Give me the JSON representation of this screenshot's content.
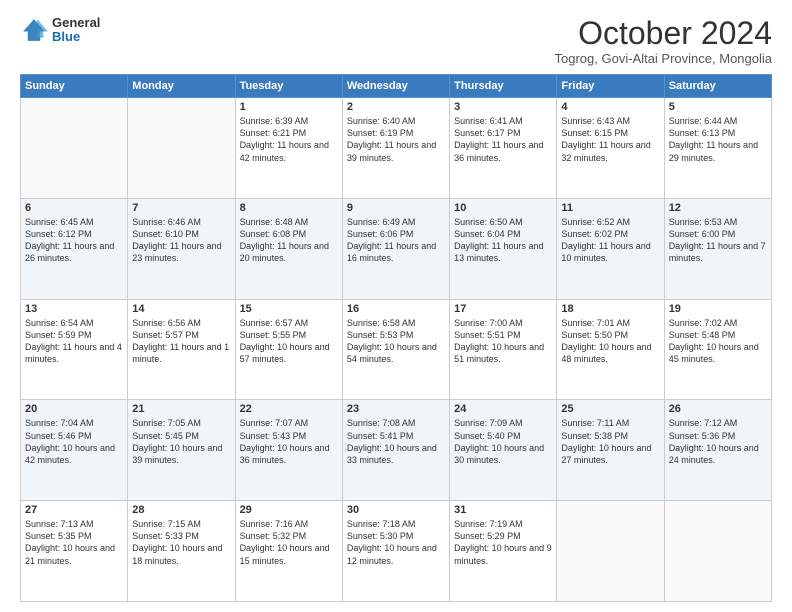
{
  "header": {
    "logo_line1": "General",
    "logo_line2": "Blue",
    "month": "October 2024",
    "location": "Togrog, Govi-Altai Province, Mongolia"
  },
  "weekdays": [
    "Sunday",
    "Monday",
    "Tuesday",
    "Wednesday",
    "Thursday",
    "Friday",
    "Saturday"
  ],
  "weeks": [
    [
      {
        "day": "",
        "info": ""
      },
      {
        "day": "",
        "info": ""
      },
      {
        "day": "1",
        "info": "Sunrise: 6:39 AM\nSunset: 6:21 PM\nDaylight: 11 hours and 42 minutes."
      },
      {
        "day": "2",
        "info": "Sunrise: 6:40 AM\nSunset: 6:19 PM\nDaylight: 11 hours and 39 minutes."
      },
      {
        "day": "3",
        "info": "Sunrise: 6:41 AM\nSunset: 6:17 PM\nDaylight: 11 hours and 36 minutes."
      },
      {
        "day": "4",
        "info": "Sunrise: 6:43 AM\nSunset: 6:15 PM\nDaylight: 11 hours and 32 minutes."
      },
      {
        "day": "5",
        "info": "Sunrise: 6:44 AM\nSunset: 6:13 PM\nDaylight: 11 hours and 29 minutes."
      }
    ],
    [
      {
        "day": "6",
        "info": "Sunrise: 6:45 AM\nSunset: 6:12 PM\nDaylight: 11 hours and 26 minutes."
      },
      {
        "day": "7",
        "info": "Sunrise: 6:46 AM\nSunset: 6:10 PM\nDaylight: 11 hours and 23 minutes."
      },
      {
        "day": "8",
        "info": "Sunrise: 6:48 AM\nSunset: 6:08 PM\nDaylight: 11 hours and 20 minutes."
      },
      {
        "day": "9",
        "info": "Sunrise: 6:49 AM\nSunset: 6:06 PM\nDaylight: 11 hours and 16 minutes."
      },
      {
        "day": "10",
        "info": "Sunrise: 6:50 AM\nSunset: 6:04 PM\nDaylight: 11 hours and 13 minutes."
      },
      {
        "day": "11",
        "info": "Sunrise: 6:52 AM\nSunset: 6:02 PM\nDaylight: 11 hours and 10 minutes."
      },
      {
        "day": "12",
        "info": "Sunrise: 6:53 AM\nSunset: 6:00 PM\nDaylight: 11 hours and 7 minutes."
      }
    ],
    [
      {
        "day": "13",
        "info": "Sunrise: 6:54 AM\nSunset: 5:59 PM\nDaylight: 11 hours and 4 minutes."
      },
      {
        "day": "14",
        "info": "Sunrise: 6:56 AM\nSunset: 5:57 PM\nDaylight: 11 hours and 1 minute."
      },
      {
        "day": "15",
        "info": "Sunrise: 6:57 AM\nSunset: 5:55 PM\nDaylight: 10 hours and 57 minutes."
      },
      {
        "day": "16",
        "info": "Sunrise: 6:58 AM\nSunset: 5:53 PM\nDaylight: 10 hours and 54 minutes."
      },
      {
        "day": "17",
        "info": "Sunrise: 7:00 AM\nSunset: 5:51 PM\nDaylight: 10 hours and 51 minutes."
      },
      {
        "day": "18",
        "info": "Sunrise: 7:01 AM\nSunset: 5:50 PM\nDaylight: 10 hours and 48 minutes."
      },
      {
        "day": "19",
        "info": "Sunrise: 7:02 AM\nSunset: 5:48 PM\nDaylight: 10 hours and 45 minutes."
      }
    ],
    [
      {
        "day": "20",
        "info": "Sunrise: 7:04 AM\nSunset: 5:46 PM\nDaylight: 10 hours and 42 minutes."
      },
      {
        "day": "21",
        "info": "Sunrise: 7:05 AM\nSunset: 5:45 PM\nDaylight: 10 hours and 39 minutes."
      },
      {
        "day": "22",
        "info": "Sunrise: 7:07 AM\nSunset: 5:43 PM\nDaylight: 10 hours and 36 minutes."
      },
      {
        "day": "23",
        "info": "Sunrise: 7:08 AM\nSunset: 5:41 PM\nDaylight: 10 hours and 33 minutes."
      },
      {
        "day": "24",
        "info": "Sunrise: 7:09 AM\nSunset: 5:40 PM\nDaylight: 10 hours and 30 minutes."
      },
      {
        "day": "25",
        "info": "Sunrise: 7:11 AM\nSunset: 5:38 PM\nDaylight: 10 hours and 27 minutes."
      },
      {
        "day": "26",
        "info": "Sunrise: 7:12 AM\nSunset: 5:36 PM\nDaylight: 10 hours and 24 minutes."
      }
    ],
    [
      {
        "day": "27",
        "info": "Sunrise: 7:13 AM\nSunset: 5:35 PM\nDaylight: 10 hours and 21 minutes."
      },
      {
        "day": "28",
        "info": "Sunrise: 7:15 AM\nSunset: 5:33 PM\nDaylight: 10 hours and 18 minutes."
      },
      {
        "day": "29",
        "info": "Sunrise: 7:16 AM\nSunset: 5:32 PM\nDaylight: 10 hours and 15 minutes."
      },
      {
        "day": "30",
        "info": "Sunrise: 7:18 AM\nSunset: 5:30 PM\nDaylight: 10 hours and 12 minutes."
      },
      {
        "day": "31",
        "info": "Sunrise: 7:19 AM\nSunset: 5:29 PM\nDaylight: 10 hours and 9 minutes."
      },
      {
        "day": "",
        "info": ""
      },
      {
        "day": "",
        "info": ""
      }
    ]
  ]
}
